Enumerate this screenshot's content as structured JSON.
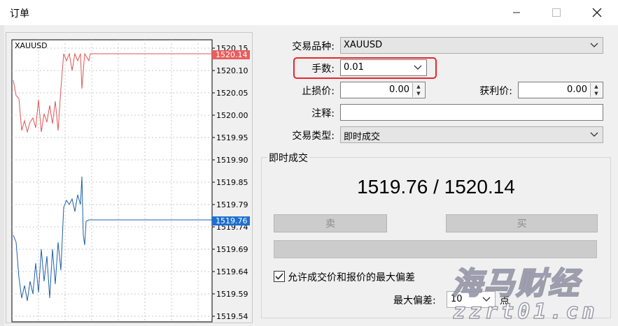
{
  "window": {
    "title": "订单"
  },
  "chart": {
    "symbol": "XAUUSD",
    "y_ticks": [
      "1520.15",
      "1520.10",
      "1520.05",
      "1520.00",
      "1519.95",
      "1519.90",
      "1519.85",
      "1519.79",
      "1519.74",
      "1519.69",
      "1519.64",
      "1519.59",
      "1519.54"
    ],
    "ask_tag": "1520.14",
    "bid_tag": "1519.76",
    "colors": {
      "ask": "#e05555",
      "bid": "#1f5fa8",
      "ask_tag_bg": "#e85e5e",
      "bid_tag_bg": "#1e6fd0"
    }
  },
  "form": {
    "symbol_label": "交易品种:",
    "symbol_value": "XAUUSD",
    "volume_label": "手数:",
    "volume_value": "0.01",
    "sl_label": "止损价:",
    "sl_value": "0.00",
    "tp_label": "获利价:",
    "tp_value": "0.00",
    "comment_label": "注释:",
    "comment_value": "",
    "type_label": "交易类型:",
    "type_value": "即时成交"
  },
  "execution": {
    "group_title": "即时成交",
    "quote": "1519.76 / 1520.14",
    "sell_label": "卖",
    "buy_label": "买",
    "allow_deviation_label": "允许成交价和报价的最大偏差",
    "allow_deviation_checked": true,
    "max_deviation_label": "最大偏差:",
    "max_deviation_value": "10",
    "deviation_unit": "点"
  },
  "watermark": {
    "line1": "海马财经",
    "line2": "zzrt01.cn"
  },
  "highlight_color": "#e8262a"
}
